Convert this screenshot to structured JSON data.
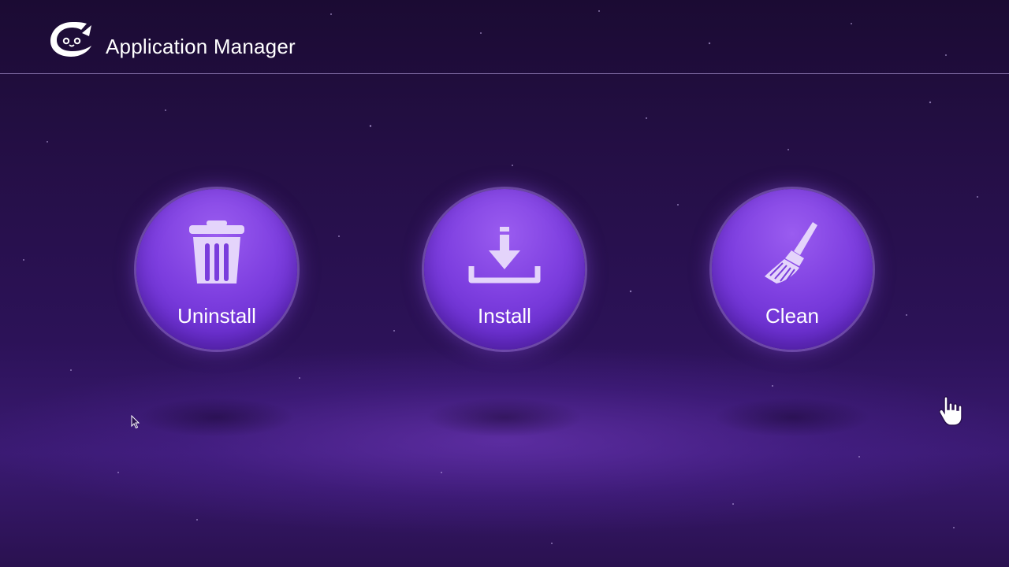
{
  "header": {
    "logo_icon": "cat-face-logo",
    "title": "Application Manager"
  },
  "actions": [
    {
      "label": "Uninstall",
      "icon": "trash-icon"
    },
    {
      "label": "Install",
      "icon": "download-icon"
    },
    {
      "label": "Clean",
      "icon": "broom-icon"
    }
  ],
  "colors": {
    "background_top": "#1b0b33",
    "background_bottom": "#3a1a72",
    "button_fill": "#7e3fe0",
    "icon_fill": "#e4d4fb",
    "text": "#ffffff"
  }
}
